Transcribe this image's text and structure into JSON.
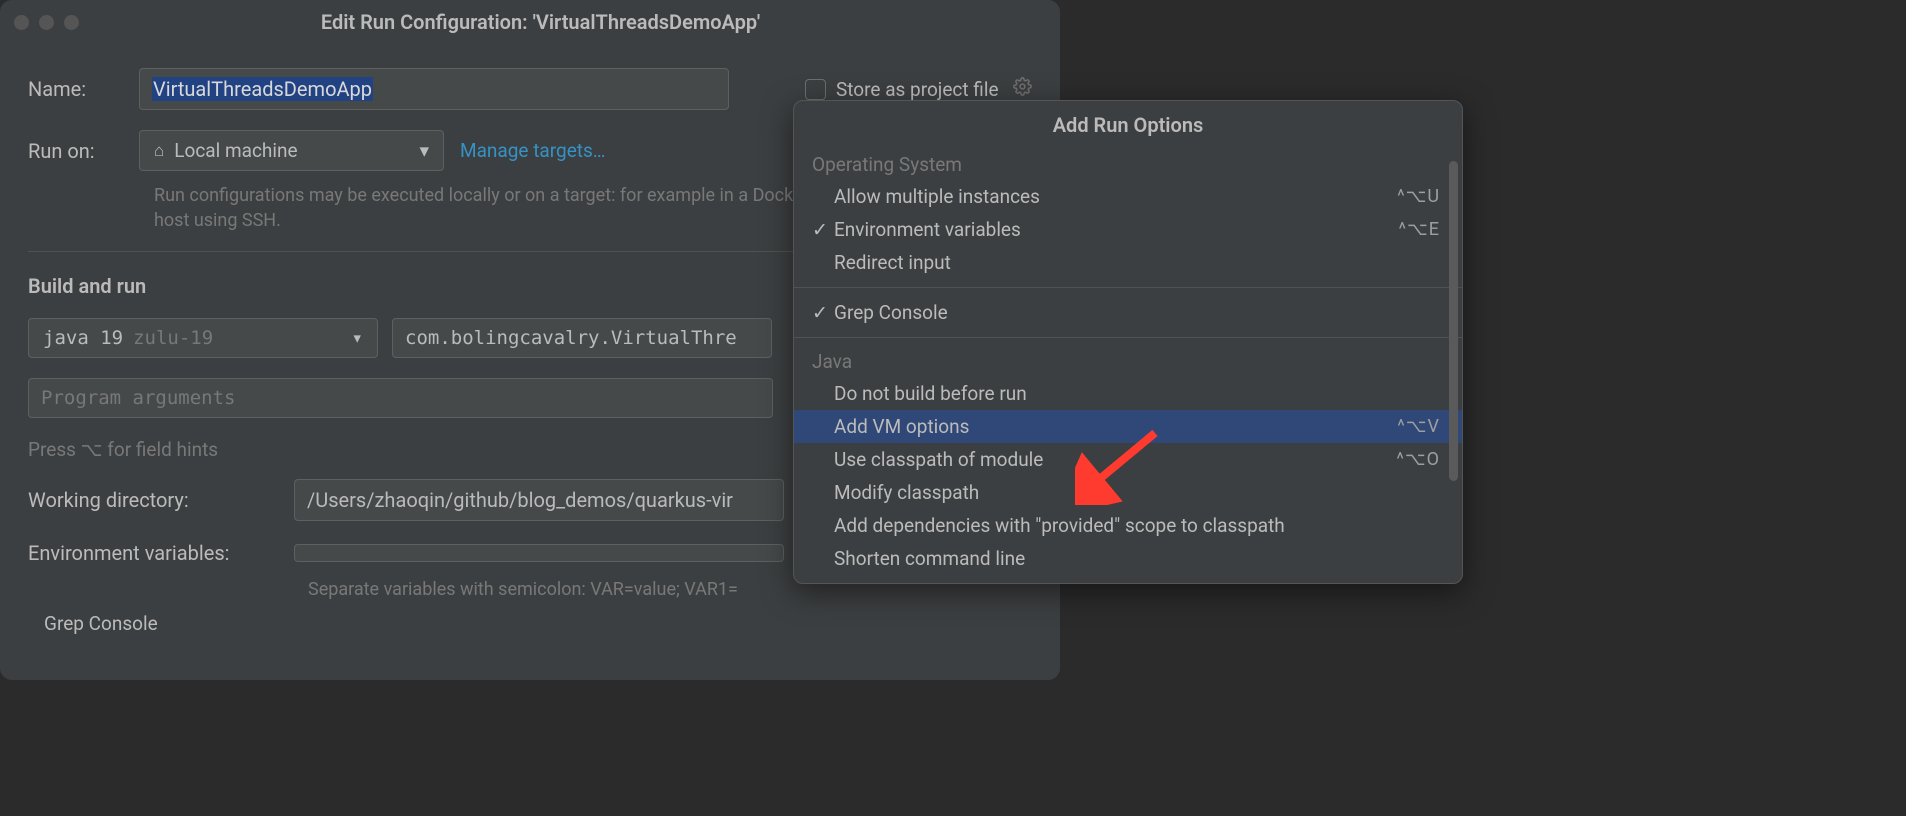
{
  "titlebar": {
    "title": "Edit Run Configuration: 'VirtualThreadsDemoApp'"
  },
  "form": {
    "name_label": "Name:",
    "name_value": "VirtualThreadsDemoApp",
    "store_label": "Store as project file",
    "run_on_label": "Run on:",
    "run_on_value": "Local machine",
    "manage_targets": "Manage targets…",
    "run_on_hint": "Run configurations may be executed locally or on a target: for example in a Docker Container or on a remote host using SSH.",
    "build_and_run": "Build and run",
    "jdk": "java 19",
    "jdk_vendor": "zulu-19",
    "main_class": "com.bolingcavalry.VirtualThre",
    "program_args_placeholder": "Program arguments",
    "field_hints": "Press ⌥ for field hints",
    "wd_label": "Working directory:",
    "wd_value": "/Users/zhaoqin/github/blog_demos/quarkus-vir",
    "env_label": "Environment variables:",
    "env_hint": "Separate variables with semicolon: VAR=value; VAR1=",
    "grep_console": "Grep Console"
  },
  "popup": {
    "title": "Add Run Options",
    "groups": [
      {
        "label": "Operating System",
        "items": [
          {
            "label": "Allow multiple instances",
            "shortcut": "^⌥U",
            "checked": false
          },
          {
            "label": "Environment variables",
            "shortcut": "^⌥E",
            "checked": true
          },
          {
            "label": "Redirect input",
            "shortcut": "",
            "checked": false
          }
        ]
      },
      {
        "label": "",
        "items": [
          {
            "label": "Grep Console",
            "shortcut": "",
            "checked": true
          }
        ]
      },
      {
        "label": "Java",
        "items": [
          {
            "label": "Do not build before run",
            "shortcut": "",
            "checked": false
          },
          {
            "label": "Add VM options",
            "shortcut": "^⌥V",
            "checked": false,
            "selected": true
          },
          {
            "label": "Use classpath of module",
            "shortcut": "^⌥O",
            "checked": false
          },
          {
            "label": "Modify classpath",
            "shortcut": "",
            "checked": false
          },
          {
            "label": "Add dependencies with \"provided\" scope to classpath",
            "shortcut": "",
            "checked": false
          },
          {
            "label": "Shorten command line",
            "shortcut": "",
            "checked": false
          }
        ]
      }
    ]
  }
}
